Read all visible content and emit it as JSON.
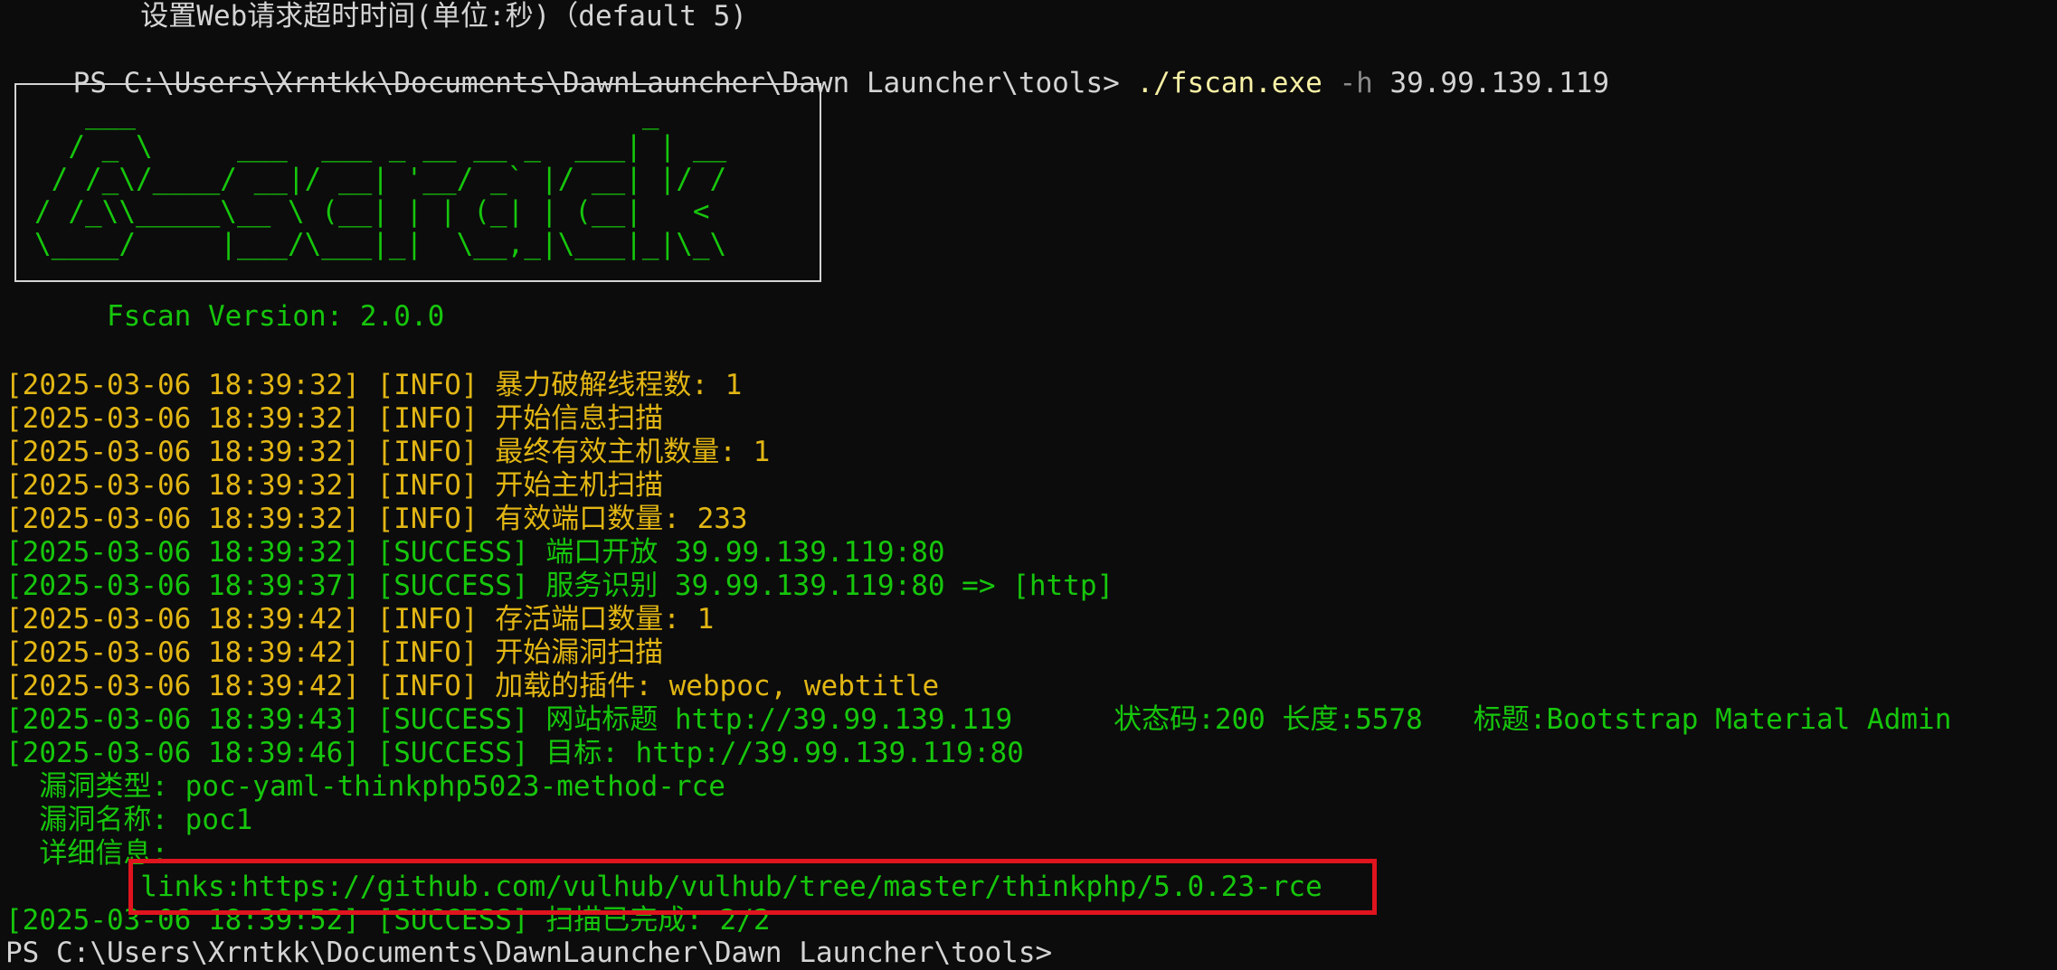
{
  "terminal": {
    "prev_help_line": "        设置Web请求超时时间(单位:秒)（default 5)",
    "prompt": "PS C:\\Users\\Xrntkk\\Documents\\DawnLauncher\\Dawn Launcher\\tools> ",
    "command_exe": "./fscan.exe",
    "command_flag": " -h",
    "command_arg": " 39.99.139.119",
    "banner_lines": [
      "   ___                              _",
      "  / _ \\     ___  ___ _ __ __ _  ___| | __",
      " / /_\\/____/ __|/ __| '__/ _` |/ __| |/ /",
      "/ /_\\\\_____\\__ \\ (__| | | (_| | (__|   <",
      "\\____/     |___/\\___|_|  \\__,_|\\___|_|\\_\\"
    ],
    "version_line": "      Fscan Version: 2.0.0",
    "log_lines": [
      {
        "text": "[2025-03-06 18:39:32] [INFO] 暴力破解线程数: 1",
        "color": "#e2b614"
      },
      {
        "text": "[2025-03-06 18:39:32] [INFO] 开始信息扫描",
        "color": "#e2b614"
      },
      {
        "text": "[2025-03-06 18:39:32] [INFO] 最终有效主机数量: 1",
        "color": "#e2b614"
      },
      {
        "text": "[2025-03-06 18:39:32] [INFO] 开始主机扫描",
        "color": "#e2b614"
      },
      {
        "text": "[2025-03-06 18:39:32] [INFO] 有效端口数量: 233",
        "color": "#e2b614"
      },
      {
        "text": "[2025-03-06 18:39:32] [SUCCESS] 端口开放 39.99.139.119:80",
        "color": "#16c60c"
      },
      {
        "text": "[2025-03-06 18:39:37] [SUCCESS] 服务识别 39.99.139.119:80 => [http]",
        "color": "#16c60c"
      },
      {
        "text": "[2025-03-06 18:39:42] [INFO] 存活端口数量: 1",
        "color": "#e2b614"
      },
      {
        "text": "[2025-03-06 18:39:42] [INFO] 开始漏洞扫描",
        "color": "#e2b614"
      },
      {
        "text": "[2025-03-06 18:39:42] [INFO] 加载的插件: webpoc, webtitle",
        "color": "#e2b614"
      },
      {
        "text": "[2025-03-06 18:39:43] [SUCCESS] 网站标题 http://39.99.139.119      状态码:200 长度:5578   标题:Bootstrap Material Admin",
        "color": "#16c60c"
      },
      {
        "text": "[2025-03-06 18:39:46] [SUCCESS] 目标: http://39.99.139.119:80",
        "color": "#16c60c"
      },
      {
        "text": "  漏洞类型: poc-yaml-thinkphp5023-method-rce",
        "color": "#16c60c"
      },
      {
        "text": "  漏洞名称: poc1",
        "color": "#16c60c"
      },
      {
        "text": "  详细信息:",
        "color": "#16c60c"
      },
      {
        "text": "        links:https://github.com/vulhub/vulhub/tree/master/thinkphp/5.0.23-rce",
        "color": "#16c60c"
      },
      {
        "text": "[2025-03-06 18:39:52] [SUCCESS] 扫描已完成: 2/2",
        "color": "#16c60c"
      }
    ],
    "final_prompt": "PS C:\\Users\\Xrntkk\\Documents\\DawnLauncher\\Dawn Launcher\\tools>",
    "highlight_color": "#e0141e"
  }
}
